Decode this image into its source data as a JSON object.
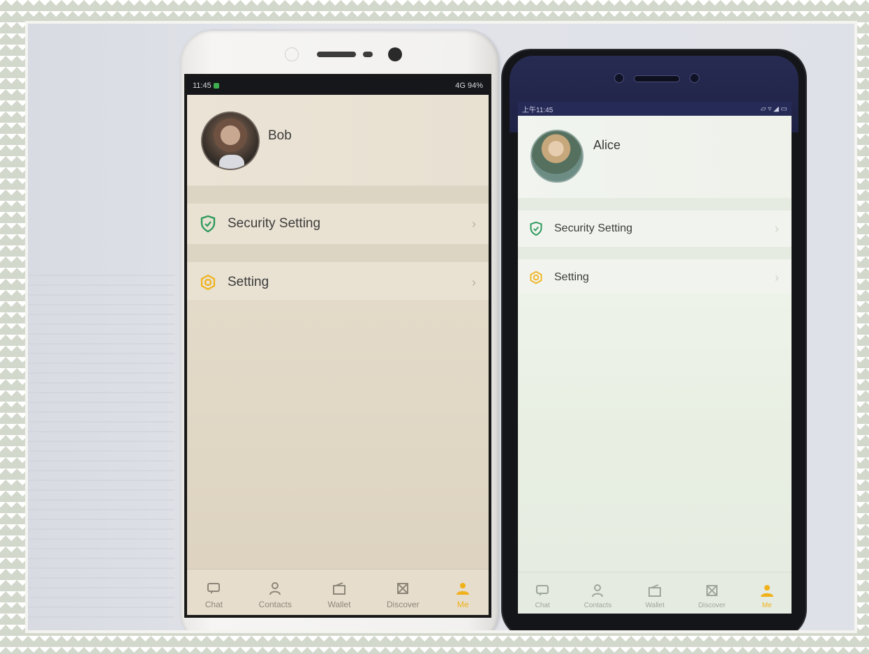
{
  "phones": [
    {
      "status_time": "11:45",
      "status_right": "4G 94%",
      "profile_name": "Bob",
      "menu": [
        {
          "label": "Security Setting",
          "icon": "shield-check-icon",
          "icon_color": "#2f9a5c"
        },
        {
          "label": "Setting",
          "icon": "gear-icon",
          "icon_color": "#f0b21b"
        }
      ],
      "tabs": [
        {
          "label": "Chat",
          "icon": "chat-icon",
          "active": false
        },
        {
          "label": "Contacts",
          "icon": "contacts-icon",
          "active": false
        },
        {
          "label": "Wallet",
          "icon": "wallet-icon",
          "active": false
        },
        {
          "label": "Discover",
          "icon": "discover-icon",
          "active": false
        },
        {
          "label": "Me",
          "icon": "me-icon",
          "active": true
        }
      ]
    },
    {
      "status_time": "上午11:45",
      "status_right": "",
      "profile_name": "Alice",
      "menu": [
        {
          "label": "Security Setting",
          "icon": "shield-check-icon",
          "icon_color": "#2f9a5c"
        },
        {
          "label": "Setting",
          "icon": "gear-icon",
          "icon_color": "#f0b21b"
        }
      ],
      "tabs": [
        {
          "label": "Chat",
          "icon": "chat-icon",
          "active": false
        },
        {
          "label": "Contacts",
          "icon": "contacts-icon",
          "active": false
        },
        {
          "label": "Wallet",
          "icon": "wallet-icon",
          "active": false
        },
        {
          "label": "Discover",
          "icon": "discover-icon",
          "active": false
        },
        {
          "label": "Me",
          "icon": "me-icon",
          "active": true
        }
      ]
    }
  ],
  "colors": {
    "accent": "#f0b21b",
    "security_green": "#2f9a5c"
  }
}
